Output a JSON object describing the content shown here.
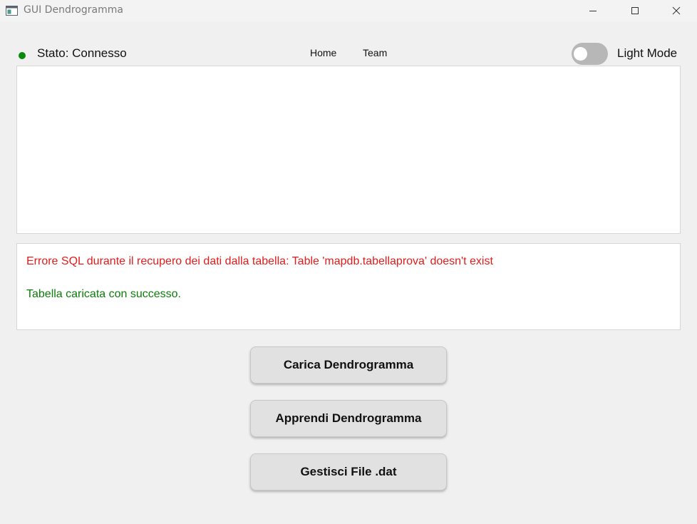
{
  "window": {
    "title": "GUI Dendrogramma",
    "icons": [
      "app-icon",
      "minimize-icon",
      "maximize-icon",
      "close-icon"
    ]
  },
  "header": {
    "status_text": "Stato: Connesso",
    "status_color": "#0a8a0a",
    "nav": [
      {
        "label": "Home"
      },
      {
        "label": "Team"
      }
    ],
    "theme_toggle": {
      "label": "Light Mode",
      "on": false
    }
  },
  "log": {
    "error_line": "Errore SQL durante il recupero dei dati dalla tabella: Table 'mapdb.tabellaprova' doesn't exist",
    "error_color": "#e31b1b",
    "success_line": "Tabella caricata con successo.",
    "success_color": "#0a7d0a"
  },
  "actions": [
    {
      "label": "Carica Dendrogramma"
    },
    {
      "label": "Apprendi Dendrogramma"
    },
    {
      "label": "Gestisci File .dat"
    }
  ]
}
